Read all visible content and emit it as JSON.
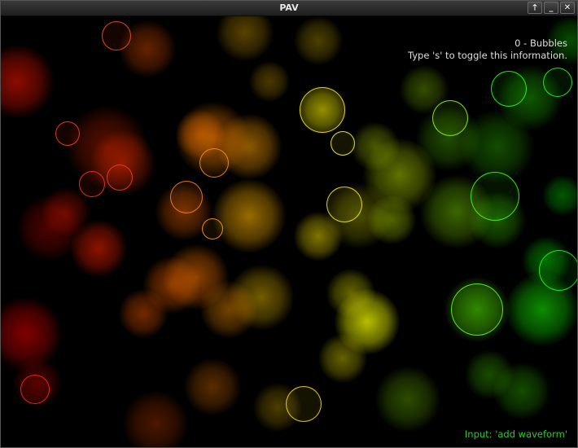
{
  "window": {
    "title": "PAV",
    "buttons": [
      {
        "name": "raise-button",
        "glyph": "🡑"
      },
      {
        "name": "minimize-button",
        "glyph": "_"
      },
      {
        "name": "close-button",
        "glyph": "✕"
      }
    ]
  },
  "overlay": {
    "mode_label": "0 - Bubbles",
    "toggle_hint": "Type 's' to toggle this information."
  },
  "status": {
    "input_text": "Input: 'add waveform'"
  },
  "colors": {
    "input_text": "#22d022",
    "info_text": "#dedede",
    "background": "#000000"
  }
}
